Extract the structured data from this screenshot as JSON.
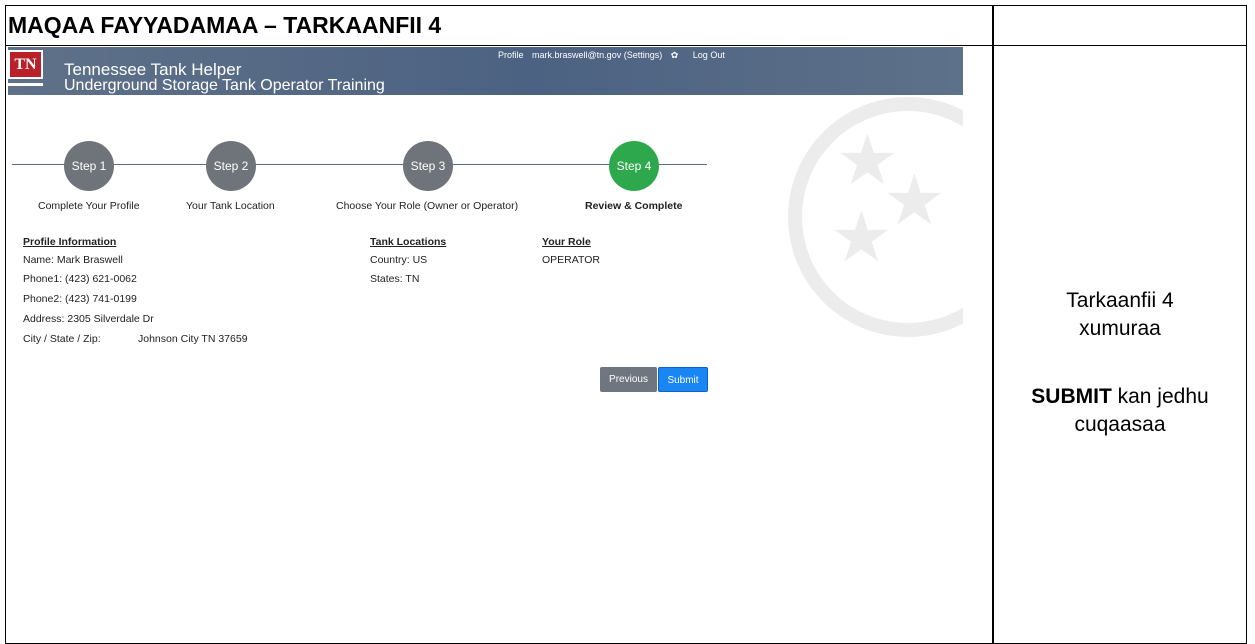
{
  "doc": {
    "title": "MAQAA FAYYADAMAA – TARKAANFII 4",
    "instructions": {
      "line1": "Tarkaanfii 4",
      "line2": "xumuraa",
      "line3_bold": "SUBMIT",
      "line3_rest": " kan jedhu",
      "line4": "cuqaasaa"
    }
  },
  "app": {
    "logo": "TN",
    "name": "Tennessee Tank Helper",
    "subtitle": "Underground Storage Tank Operator Training",
    "topnav": {
      "profile": "Profile",
      "email": "mark.braswell@tn.gov (Settings)",
      "settings_icon": "gear-icon",
      "logout": "Log Out"
    },
    "steps": [
      {
        "label": "Step 1",
        "caption": "Complete Your Profile",
        "active": false
      },
      {
        "label": "Step 2",
        "caption": "Your Tank Location",
        "active": false
      },
      {
        "label": "Step 3",
        "caption": "Choose Your Role (Owner or Operator)",
        "active": false
      },
      {
        "label": "Step 4",
        "caption": "Review & Complete",
        "active": true
      }
    ],
    "profile": {
      "heading": "Profile Information",
      "name": "Name: Mark Braswell",
      "phone1": "Phone1: (423) 621-0062",
      "phone2": "Phone2: (423) 741-0199",
      "address": "Address: 2305 Silverdale Dr",
      "city_label": "City / State / Zip:",
      "city_value": "Johnson City TN 37659"
    },
    "tank": {
      "heading": "Tank Locations",
      "country": "Country: US",
      "states": "States: TN"
    },
    "role": {
      "heading": "Your Role",
      "value": "OPERATOR"
    },
    "buttons": {
      "previous": "Previous",
      "submit": "Submit"
    },
    "colors": {
      "header_bar": "#4c6282",
      "step_inactive": "#6f747a",
      "step_active": "#2ea84c",
      "submit": "#1a86f4",
      "previous": "#6f7680"
    }
  }
}
